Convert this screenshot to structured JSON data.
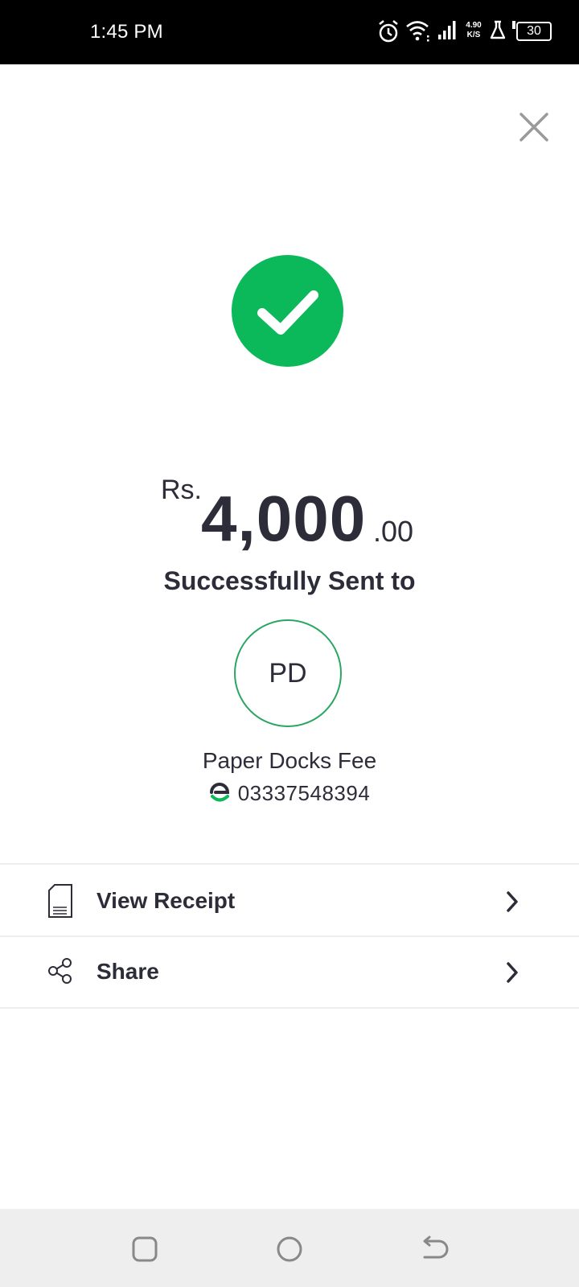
{
  "status_bar": {
    "time": "1:45 PM",
    "net_speed_value": "4.90",
    "net_speed_unit": "K/S",
    "battery": "30",
    "icons": [
      "alarm-icon",
      "wifi-icon",
      "signal-icon",
      "lab-icon",
      "battery-icon"
    ]
  },
  "close": {
    "icon": "close-icon"
  },
  "success": {
    "icon": "check-icon",
    "color": "#0bb85a"
  },
  "amount": {
    "currency": "Rs.",
    "whole": "4,000",
    "fraction": ".00"
  },
  "message": "Successfully Sent to",
  "recipient": {
    "initials": "PD",
    "name": "Paper Docks Fee",
    "number": "03337548394",
    "wallet_icon": "easypaisa-icon"
  },
  "actions": [
    {
      "label": "View Receipt",
      "icon": "receipt-icon"
    },
    {
      "label": "Share",
      "icon": "share-icon"
    }
  ],
  "nav_bar": {
    "icons": [
      "recents-icon",
      "home-icon",
      "back-icon"
    ]
  },
  "colors": {
    "accent_green": "#0bb85a",
    "avatar_ring": "#2aa562",
    "text": "#2d2d3a"
  }
}
